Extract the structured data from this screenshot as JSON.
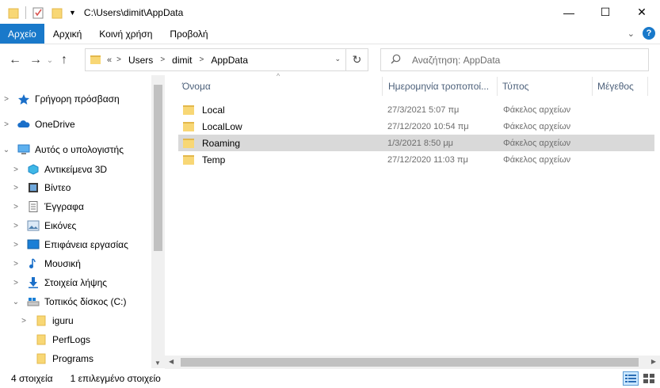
{
  "window": {
    "title": "C:\\Users\\dimit\\AppData",
    "minimize": "—",
    "maximize": "☐",
    "close": "✕"
  },
  "ribbon": {
    "tabs": [
      {
        "label": "Αρχείο"
      },
      {
        "label": "Αρχική"
      },
      {
        "label": "Κοινή χρήση"
      },
      {
        "label": "Προβολή"
      }
    ],
    "help_label": "?"
  },
  "address": {
    "overflow": "«",
    "crumbs": [
      "Users",
      "dimit",
      "AppData"
    ]
  },
  "search": {
    "placeholder": "Αναζήτηση: AppData"
  },
  "nav": {
    "items": [
      {
        "label": "Γρήγορη πρόσβαση",
        "icon": "star-icon"
      },
      {
        "label": "OneDrive",
        "icon": "cloud-icon"
      },
      {
        "label": "Αυτός ο υπολογιστής",
        "icon": "computer-icon"
      },
      {
        "label": "Αντικείμενα 3D",
        "icon": "cube-icon"
      },
      {
        "label": "Βίντεο",
        "icon": "video-icon"
      },
      {
        "label": "Έγγραφα",
        "icon": "document-icon"
      },
      {
        "label": "Εικόνες",
        "icon": "pictures-icon"
      },
      {
        "label": "Επιφάνεια εργασίας",
        "icon": "desktop-icon"
      },
      {
        "label": "Μουσική",
        "icon": "music-icon"
      },
      {
        "label": "Στοιχεία λήψης",
        "icon": "download-icon"
      },
      {
        "label": "Τοπικός δίσκος (C:)",
        "icon": "drive-icon"
      },
      {
        "label": "iguru",
        "icon": "folder-icon"
      },
      {
        "label": "PerfLogs",
        "icon": "folder-icon"
      },
      {
        "label": "Programs",
        "icon": "folder-icon"
      }
    ]
  },
  "columns": {
    "name": "Όνομα",
    "date": "Ημερομηνία τροποποί...",
    "type": "Τύπος",
    "size": "Μέγεθος"
  },
  "files": [
    {
      "name": "Local",
      "date": "27/3/2021 5:07 πμ",
      "type": "Φάκελος αρχείων"
    },
    {
      "name": "LocalLow",
      "date": "27/12/2020 10:54 πμ",
      "type": "Φάκελος αρχείων"
    },
    {
      "name": "Roaming",
      "date": "1/3/2021 8:50 μμ",
      "type": "Φάκελος αρχείων"
    },
    {
      "name": "Temp",
      "date": "27/12/2020 11:03 πμ",
      "type": "Φάκελος αρχείων"
    }
  ],
  "status": {
    "count": "4 στοιχεία",
    "selected": "1 επιλεγμένο στοιχείο"
  },
  "colors": {
    "accent": "#1979ca",
    "folder": "#f8d775",
    "selection": "#d9d9d9"
  }
}
